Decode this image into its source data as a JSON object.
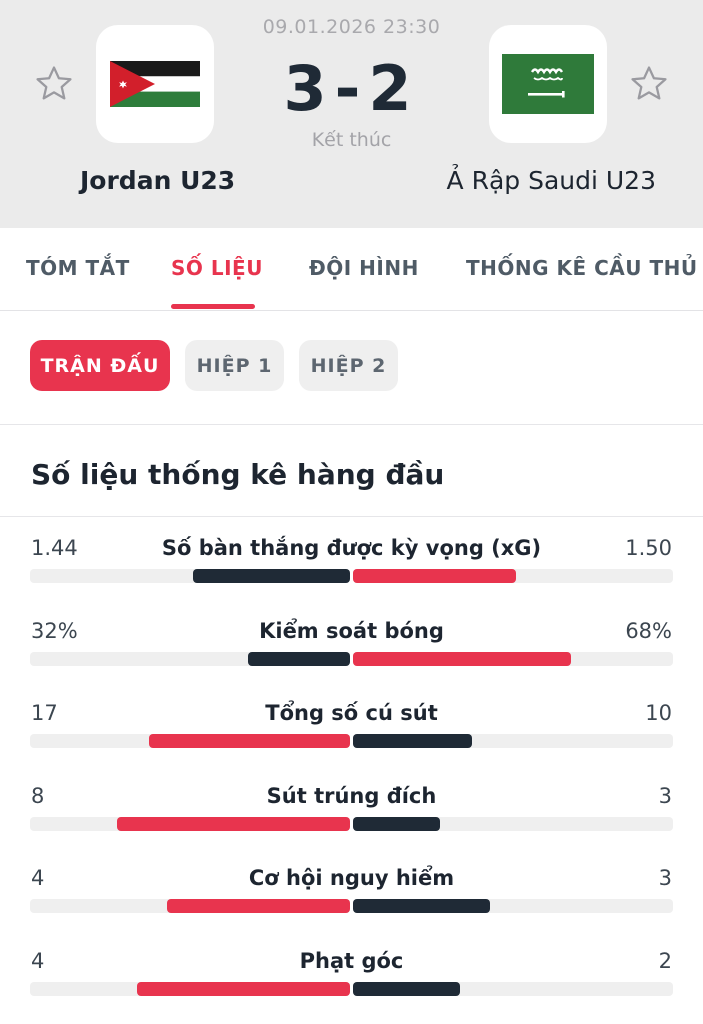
{
  "match": {
    "datetime": "09.01.2026 23:30",
    "score": "3-2",
    "status": "Kết thúc",
    "home": {
      "name": "Jordan U23",
      "flag_icon": "jordan-flag-icon"
    },
    "away": {
      "name": "Ả Rập Saudi U23",
      "flag_icon": "saudi-arabia-flag-icon"
    }
  },
  "tabs": [
    {
      "label": "TÓM TẮT",
      "active": false
    },
    {
      "label": "SỐ LIỆU",
      "active": true
    },
    {
      "label": "ĐỘI HÌNH",
      "active": false
    },
    {
      "label": "THỐNG KÊ CẦU THỦ",
      "active": false
    }
  ],
  "periods": [
    {
      "label": "TRẬN ĐẤU",
      "active": true
    },
    {
      "label": "HIỆP 1",
      "active": false
    },
    {
      "label": "HIỆP 2",
      "active": false
    }
  ],
  "section_title": "Số liệu thống kê hàng đầu",
  "colors": {
    "accent": "#e8344e",
    "dark": "#1f2a36",
    "track": "#efefef"
  },
  "stats": [
    {
      "label": "Số bàn thắng được kỳ vọng (xG)",
      "home": "1.44",
      "away": "1.50",
      "home_value": 1.44,
      "away_value": 1.5,
      "leader": "away"
    },
    {
      "label": "Kiểm soát bóng",
      "home": "32%",
      "away": "68%",
      "home_value": 32,
      "away_value": 68,
      "leader": "away"
    },
    {
      "label": "Tổng số cú sút",
      "home": "17",
      "away": "10",
      "home_value": 17,
      "away_value": 10,
      "leader": "home"
    },
    {
      "label": "Sút trúng đích",
      "home": "8",
      "away": "3",
      "home_value": 8,
      "away_value": 3,
      "leader": "home"
    },
    {
      "label": "Cơ hội nguy hiểm",
      "home": "4",
      "away": "3",
      "home_value": 4,
      "away_value": 3,
      "leader": "home"
    },
    {
      "label": "Phạt góc",
      "home": "4",
      "away": "2",
      "home_value": 4,
      "away_value": 2,
      "leader": "home"
    }
  ]
}
